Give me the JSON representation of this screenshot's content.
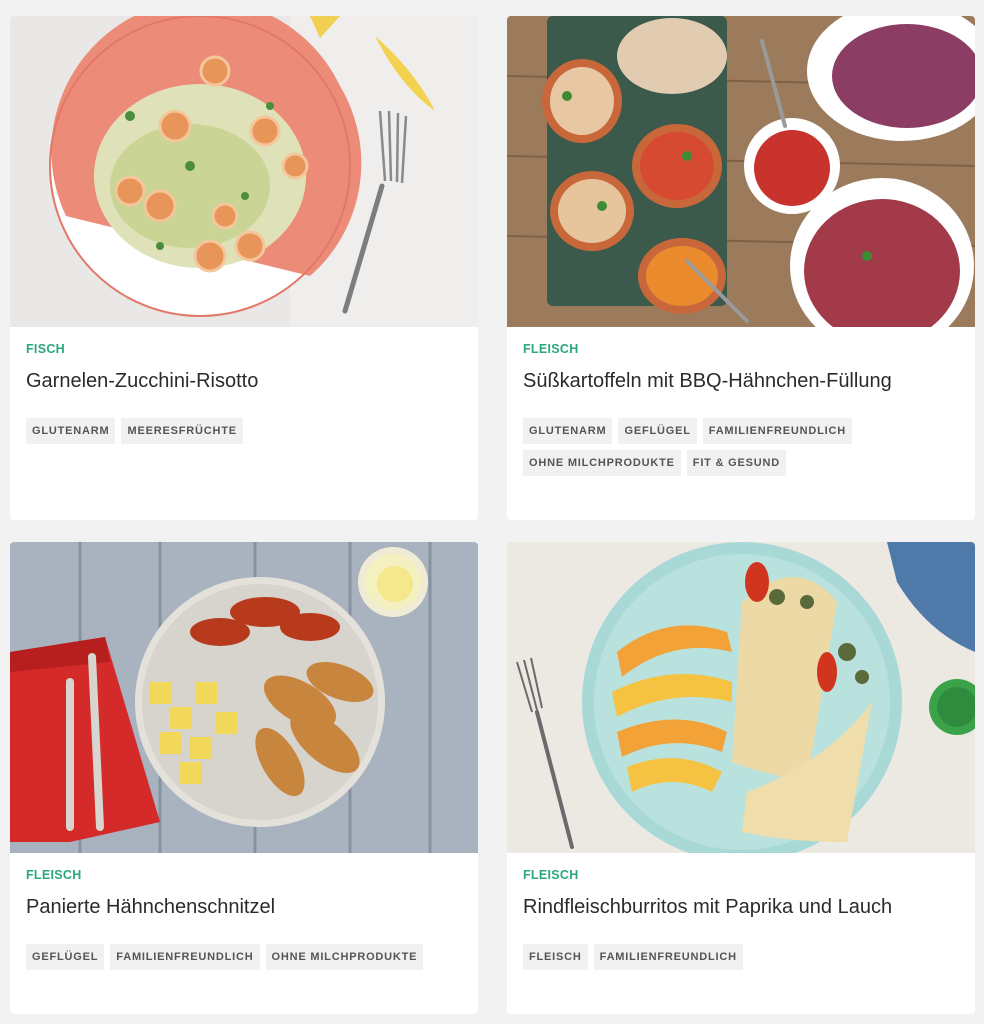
{
  "cards": [
    {
      "category": "FISCH",
      "title": "Garnelen-Zucchini-Risotto",
      "tags": [
        "GLUTENARM",
        "MEERESFRÜCHTE"
      ]
    },
    {
      "category": "FLEISCH",
      "title": "Süßkartoffeln mit BBQ-Hähnchen-Füllung",
      "tags": [
        "GLUTENARM",
        "GEFLÜGEL",
        "FAMILIENFREUNDLICH",
        "OHNE MILCHPRODUKTE",
        "FIT & GESUND"
      ]
    },
    {
      "category": "FLEISCH",
      "title": "Panierte Hähnchenschnitzel",
      "tags": [
        "GEFLÜGEL",
        "FAMILIENFREUNDLICH",
        "OHNE MILCHPRODUKTE"
      ]
    },
    {
      "category": "FLEISCH",
      "title": "Rindfleischburritos mit Paprika und Lauch",
      "tags": [
        "FLEISCH",
        "FAMILIENFREUNDLICH"
      ]
    }
  ],
  "colors": {
    "page_bg": "#f2f2f2",
    "card_bg": "#ffffff",
    "category": "#2aa87a",
    "title": "#2b2b2b",
    "tag_bg": "#f1f1f1",
    "tag_text": "#555555"
  }
}
